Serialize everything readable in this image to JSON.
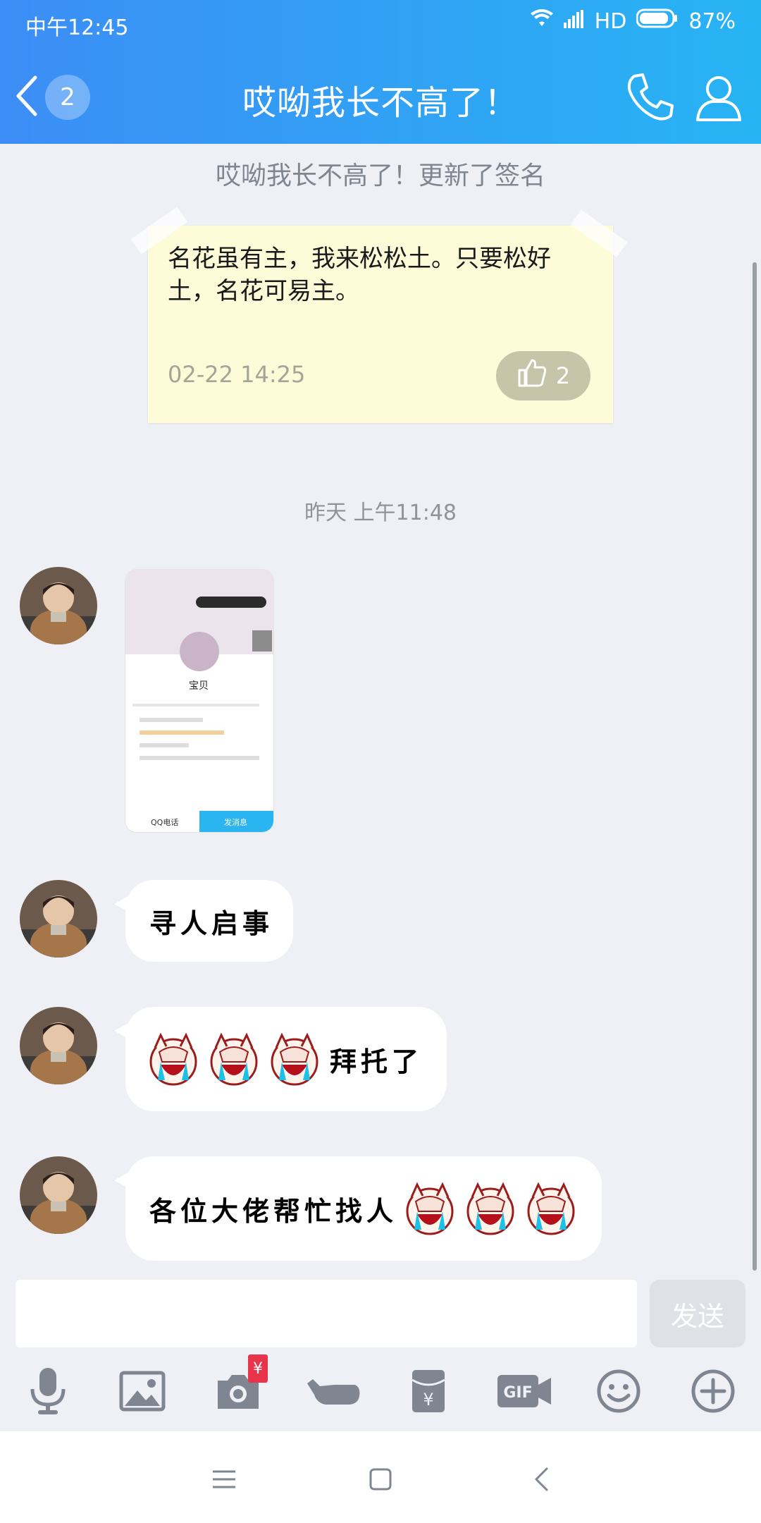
{
  "status_bar": {
    "time": "中午12:45",
    "network": "HD",
    "battery": "87%"
  },
  "header": {
    "title": "哎呦我长不高了！",
    "unread_count": "2"
  },
  "system_notice": "哎呦我长不高了！更新了签名",
  "signature_note": {
    "text": "名花虽有主，我来松松土。只要松好土，名花可易主。",
    "timestamp": "02-22 14:25",
    "likes": "2"
  },
  "time_divider": "昨天 上午11:48",
  "image_message": {
    "profile_name": "宝贝",
    "qq_call_label": "QQ电话",
    "send_message_label": "发消息"
  },
  "messages": [
    {
      "text": "寻人启事"
    },
    {
      "text": "拜托了",
      "emoji": "laughing-cry-emoji"
    },
    {
      "text": "各位大佬帮忙找人",
      "emoji": "laughing-cry-emoji"
    }
  ],
  "input": {
    "placeholder": "",
    "send_label": "发送"
  },
  "toolbar": {
    "items": [
      "microphone-icon",
      "image-icon",
      "camera-icon",
      "poke-icon",
      "red-packet-icon",
      "gif-icon",
      "emoji-icon",
      "plus-icon"
    ],
    "camera_badge": "¥"
  },
  "colors": {
    "header_start": "#3c8df5",
    "header_end": "#27b4f4",
    "background": "#eef0f5",
    "note_bg": "#fdfbd8"
  }
}
